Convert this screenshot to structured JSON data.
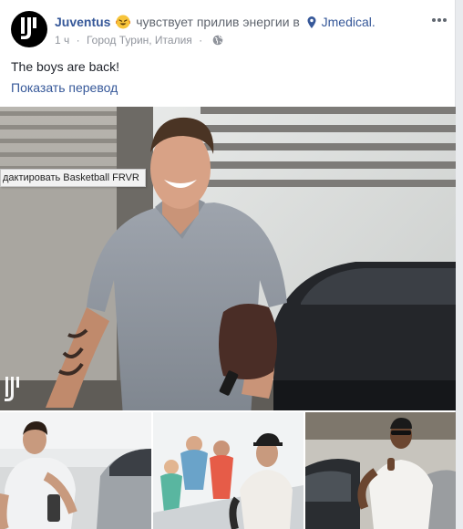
{
  "post": {
    "author": "Juventus",
    "feeling": "чувствует прилив энергии в",
    "place": "Jmedical.",
    "time": "1 ч",
    "location": "Город Турин, Италия",
    "text": "The boys are back!",
    "translate": "Показать перевод"
  },
  "tooltip": "дактировать Basketball FRVR",
  "icons": {
    "avatar": "juventus-logo-icon",
    "emoji": "energized-emoji-icon",
    "place": "location-pin-icon",
    "privacy": "globe-icon",
    "more": "more-options-icon"
  },
  "colors": {
    "link": "#365899",
    "meta": "#90949c",
    "text": "#1d2129"
  }
}
